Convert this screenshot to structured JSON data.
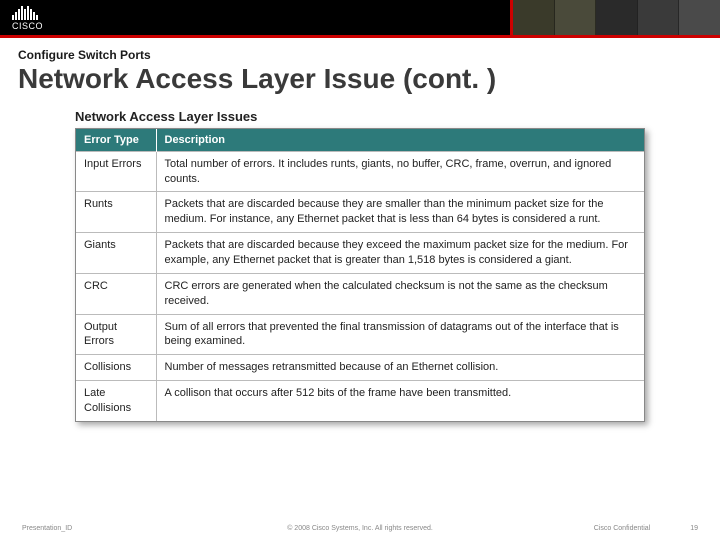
{
  "brand": {
    "name": "CISCO"
  },
  "header": {
    "kicker": "Configure Switch Ports",
    "title": "Network Access Layer Issue (cont. )"
  },
  "panel": {
    "title": "Network Access Layer Issues",
    "columns": [
      "Error Type",
      "Description"
    ],
    "rows": [
      {
        "type": "Input Errors",
        "desc": "Total number of errors. It includes runts, giants, no buffer, CRC, frame, overrun, and ignored counts."
      },
      {
        "type": "Runts",
        "desc": "Packets that are discarded because they are smaller than the minimum packet size for the medium. For instance, any Ethernet packet that is less than 64 bytes is considered a runt."
      },
      {
        "type": "Giants",
        "desc": "Packets that are discarded because they exceed the maximum packet size for the medium. For example, any Ethernet packet that is greater than 1,518 bytes is considered a giant."
      },
      {
        "type": "CRC",
        "desc": "CRC errors are generated when the calculated checksum is not the same as the checksum received."
      },
      {
        "type": "Output Errors",
        "desc": "Sum of all errors that prevented the final transmission of datagrams out of the interface that is being examined."
      },
      {
        "type": "Collisions",
        "desc": "Number of messages retransmitted because of an Ethernet collision."
      },
      {
        "type": "Late Collisions",
        "desc": "A collison that occurs after 512 bits of the frame have been transmitted."
      }
    ]
  },
  "footer": {
    "left": "Presentation_ID",
    "center": "© 2008 Cisco Systems, Inc. All rights reserved.",
    "confidential": "Cisco Confidential",
    "page": "19"
  }
}
